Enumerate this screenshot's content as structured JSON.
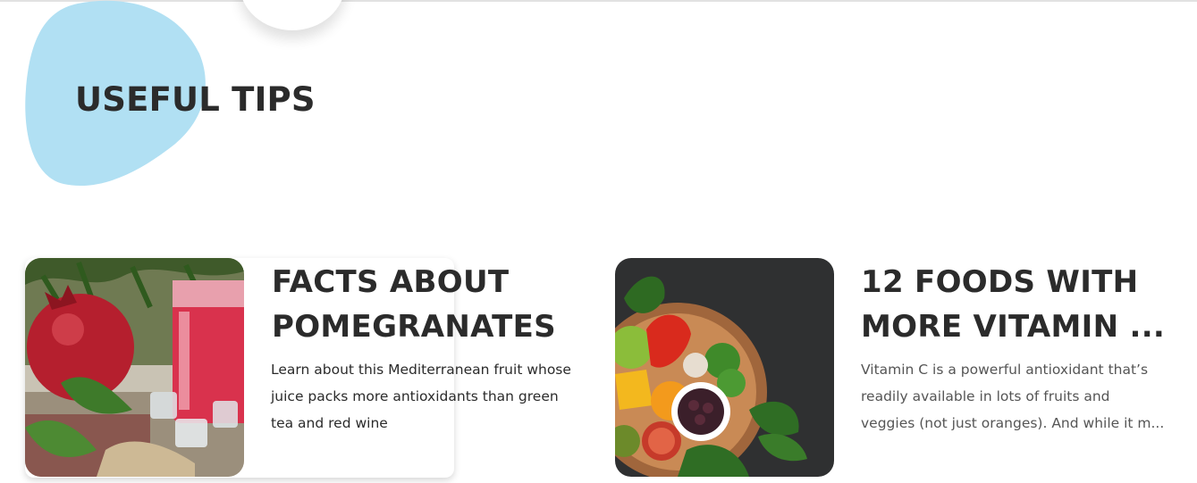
{
  "section": {
    "title": "USEFUL TIPS"
  },
  "cards": [
    {
      "title_line1": "FACTS ABOUT",
      "title_line2": "POMEGRANATES",
      "desc_line1": "Learn about this Mediterranean fruit whose",
      "desc_line2": "juice packs more antioxidants than green",
      "desc_line3": "tea and red wine",
      "image": "pomegranate-juice-photo"
    },
    {
      "title_line1": "12 FOODS WITH",
      "title_line2": "MORE VITAMIN ...",
      "desc_line1": "Vitamin C is a powerful antioxidant that’s",
      "desc_line2": "readily available in lots of fruits and",
      "desc_line3": "veggies (not just oranges). And while it m...",
      "image": "vitamin-c-foods-photo"
    }
  ],
  "colors": {
    "blob": "#b1e0f3",
    "text": "#2b2b2b"
  }
}
